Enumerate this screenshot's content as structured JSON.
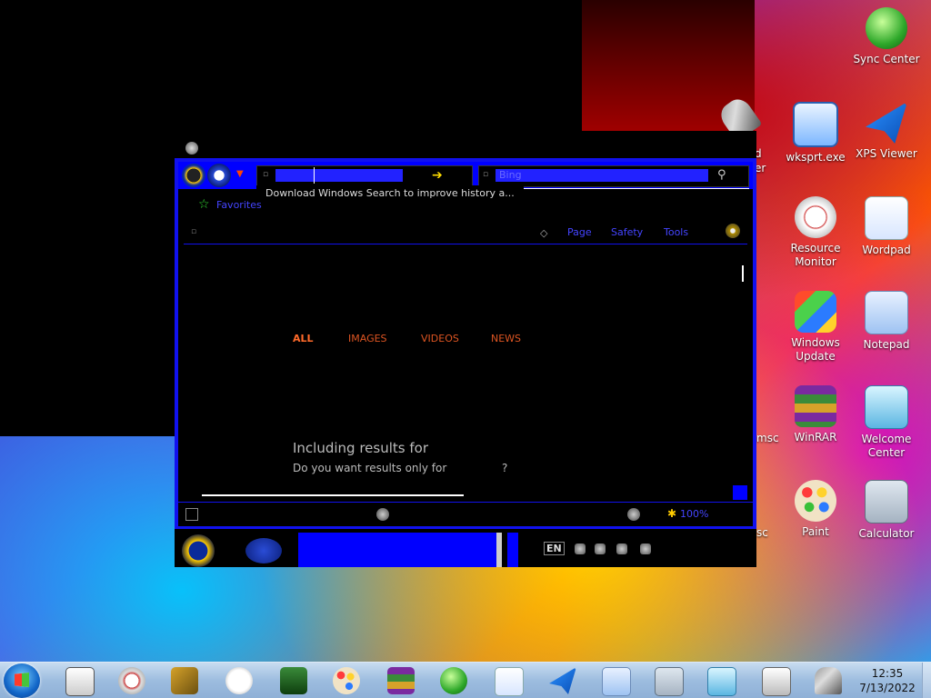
{
  "desktop": {
    "icons": [
      {
        "label": "Sync Center",
        "icon": "sync-icon"
      },
      {
        "label": "wksprt.exe",
        "icon": "remote-desktop-icon"
      },
      {
        "label": "XPS Viewer",
        "icon": "xps-viewer-icon"
      },
      {
        "label": "Resource Monitor",
        "icon": "resource-monitor-icon"
      },
      {
        "label": "Wordpad",
        "icon": "wordpad-icon"
      },
      {
        "label": "Windows Update",
        "icon": "windows-update-icon"
      },
      {
        "label": "Notepad",
        "icon": "notepad-icon"
      },
      {
        "label": "WinRAR",
        "icon": "winrar-icon"
      },
      {
        "label": "Welcome Center",
        "icon": "welcome-center-icon"
      },
      {
        "label": "Paint",
        "icon": "paint-icon"
      },
      {
        "label": "Calculator",
        "icon": "calculator-icon"
      }
    ],
    "partial_labels": [
      "d",
      "er",
      "msc",
      "sc"
    ]
  },
  "browser": {
    "favorites_label": "Favorites",
    "address_placeholder": "",
    "search_placeholder": "Bing",
    "autocomplete_hint": "Download Windows Search to improve history a...",
    "commands": [
      "Page",
      "Safety",
      "Tools"
    ],
    "scope_tabs": [
      "ALL",
      "IMAGES",
      "VIDEOS",
      "NEWS"
    ],
    "including_results": "Including results for",
    "do_you_want": "Do you want results only for",
    "question_mark": "?",
    "zoom": "100%"
  },
  "inner_taskbar": {
    "lang": "EN"
  },
  "taskbar": {
    "time": "12:35",
    "date": "7/13/2022",
    "pinned": [
      "file-icon",
      "resource-monitor-icon",
      "keys-icon",
      "clock-icon",
      "network-icon",
      "paint-icon",
      "winrar-icon",
      "sync-icon",
      "wordpad-icon",
      "xps-viewer-icon",
      "notepad-icon",
      "calculator-icon",
      "welcome-center-icon",
      "xml-icon",
      "microphone-icon"
    ]
  }
}
